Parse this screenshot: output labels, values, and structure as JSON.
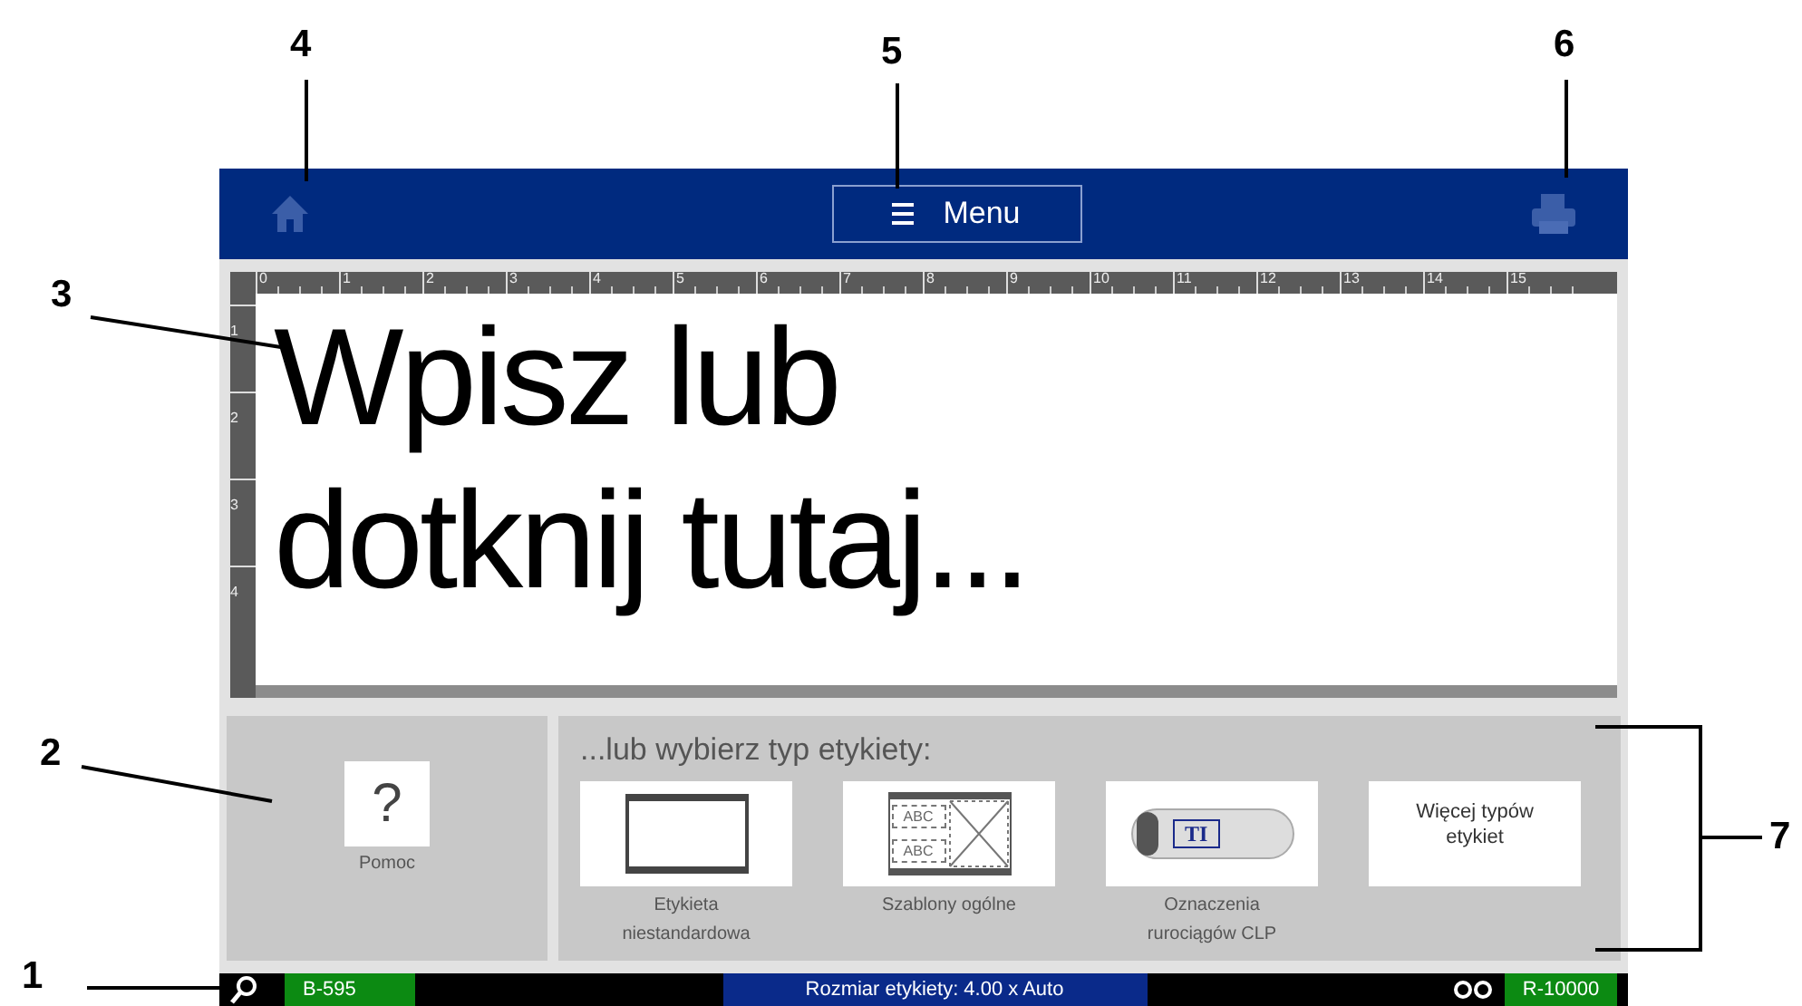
{
  "callouts": [
    "1",
    "2",
    "3",
    "4",
    "5",
    "6",
    "7"
  ],
  "header": {
    "menu_label": "Menu"
  },
  "ruler": {
    "top_marks": [
      "0",
      "1",
      "2",
      "3",
      "4",
      "5",
      "6",
      "7",
      "8",
      "9",
      "10",
      "11",
      "12",
      "13",
      "14",
      "15"
    ],
    "side_marks": [
      "1",
      "2",
      "3",
      "4"
    ]
  },
  "editor": {
    "placeholder_lines": [
      "Wpisz lub",
      "dotknij tutaj..."
    ]
  },
  "help": {
    "icon_text": "?",
    "label": "Pomoc"
  },
  "label_types": {
    "heading": "...lub wybierz typ etykiety:",
    "items": [
      {
        "kind": "blank",
        "caption": "Etykieta niestandardowa"
      },
      {
        "kind": "template",
        "caption": "Szablony ogólne",
        "tile_lines": [
          "ABC",
          "ABC"
        ]
      },
      {
        "kind": "pipe",
        "caption": "Oznaczenia rurociągów CLP",
        "tile_lines": [
          "TI"
        ]
      },
      {
        "kind": "text",
        "tile_text": "Więcej typów etykiet"
      }
    ]
  },
  "status_bar": {
    "printer_model": "B-595",
    "label_size": "Rozmiar etykiety: 4.00 x Auto",
    "ribbon": "R-10000"
  }
}
